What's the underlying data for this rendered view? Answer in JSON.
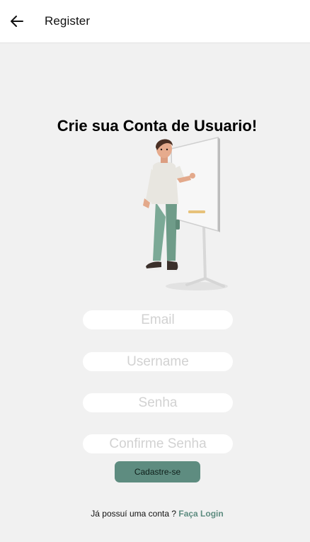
{
  "appbar": {
    "title": "Register",
    "back_icon": "arrow-left-icon"
  },
  "main": {
    "headline": "Crie sua Conta de Usuario!",
    "illustration": "person-presenting-whiteboard-illustration"
  },
  "form": {
    "email_placeholder": "Email",
    "username_placeholder": "Username",
    "password_placeholder": "Senha",
    "confirm_password_placeholder": "Confirme Senha",
    "submit_label": "Cadastre-se"
  },
  "footer": {
    "prompt": "Já possuí uma conta ?",
    "login_link": "Faça Login"
  },
  "colors": {
    "background": "#f1f1f1",
    "accent": "#5e8c80",
    "field": "#ffffff"
  }
}
